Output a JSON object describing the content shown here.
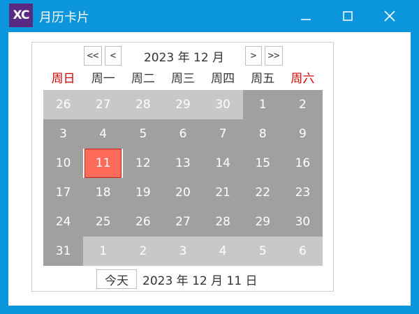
{
  "window": {
    "logo_text": "XC",
    "title": "月历卡片",
    "frame_color": "#0b95dc",
    "logo_color": "#5a2a82"
  },
  "calendar": {
    "prev_year_label": "<<",
    "prev_month_label": "<",
    "next_month_label": ">",
    "next_year_label": ">>",
    "month_label": "2023 年 12 月",
    "weekdays": [
      "周日",
      "周一",
      "周二",
      "周三",
      "周四",
      "周五",
      "周六"
    ],
    "weekend_color": "#d40000",
    "days": [
      {
        "label": "26",
        "current": false
      },
      {
        "label": "27",
        "current": false
      },
      {
        "label": "28",
        "current": false
      },
      {
        "label": "29",
        "current": false
      },
      {
        "label": "30",
        "current": false
      },
      {
        "label": "1",
        "current": true
      },
      {
        "label": "2",
        "current": true
      },
      {
        "label": "3",
        "current": true
      },
      {
        "label": "4",
        "current": true
      },
      {
        "label": "5",
        "current": true
      },
      {
        "label": "6",
        "current": true
      },
      {
        "label": "7",
        "current": true
      },
      {
        "label": "8",
        "current": true
      },
      {
        "label": "9",
        "current": true
      },
      {
        "label": "10",
        "current": true
      },
      {
        "label": "11",
        "current": true,
        "selected": true
      },
      {
        "label": "12",
        "current": true
      },
      {
        "label": "13",
        "current": true
      },
      {
        "label": "14",
        "current": true
      },
      {
        "label": "15",
        "current": true
      },
      {
        "label": "16",
        "current": true
      },
      {
        "label": "17",
        "current": true
      },
      {
        "label": "18",
        "current": true
      },
      {
        "label": "19",
        "current": true
      },
      {
        "label": "20",
        "current": true
      },
      {
        "label": "21",
        "current": true
      },
      {
        "label": "22",
        "current": true
      },
      {
        "label": "23",
        "current": true
      },
      {
        "label": "24",
        "current": true
      },
      {
        "label": "25",
        "current": true
      },
      {
        "label": "26",
        "current": true
      },
      {
        "label": "27",
        "current": true
      },
      {
        "label": "28",
        "current": true
      },
      {
        "label": "29",
        "current": true
      },
      {
        "label": "30",
        "current": true
      },
      {
        "label": "31",
        "current": true
      },
      {
        "label": "1",
        "current": false
      },
      {
        "label": "2",
        "current": false
      },
      {
        "label": "3",
        "current": false
      },
      {
        "label": "4",
        "current": false
      },
      {
        "label": "5",
        "current": false
      },
      {
        "label": "6",
        "current": false
      }
    ],
    "selected_color": "#ff6b5a",
    "today_button_label": "今天",
    "selected_date_text": "2023 年 12 月 11 日"
  }
}
